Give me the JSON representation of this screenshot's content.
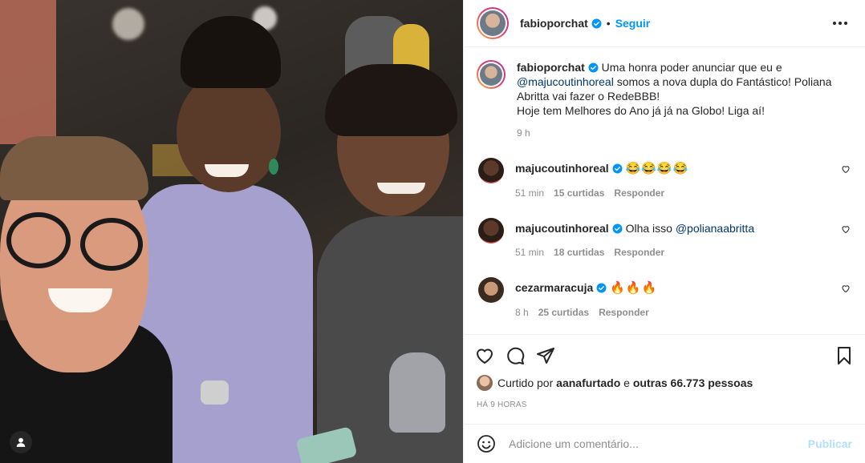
{
  "post": {
    "author": "fabioporchat",
    "follow_label": "Seguir",
    "caption_parts": {
      "p1": "Uma honra poder anunciar que eu e ",
      "mention": "@majucoutinhoreal",
      "p2": " somos a nova dupla do Fantástico! Poliana Abritta vai fazer o RedeBBB!",
      "p3": "Hoje tem Melhores do Ano já já na Globo! Liga aí!"
    },
    "caption_time": "9 h"
  },
  "comments": [
    {
      "user": "majucoutinhoreal",
      "text": "😂😂😂😂",
      "mention": "",
      "time": "51 min",
      "likes": "15 curtidas",
      "reply": "Responder"
    },
    {
      "user": "majucoutinhoreal",
      "text": "Olha isso ",
      "mention": "@polianaabritta",
      "time": "51 min",
      "likes": "18 curtidas",
      "reply": "Responder"
    },
    {
      "user": "cezarmaracuja",
      "text": "🔥🔥🔥",
      "mention": "",
      "time": "8 h",
      "likes": "25 curtidas",
      "reply": "Responder"
    }
  ],
  "likes_line": {
    "prefix": "Curtido por ",
    "user": "aanafurtado",
    "middle": " e ",
    "others": "outras 66.773 pessoas"
  },
  "time_ago": "HÁ 9 HORAS",
  "comment_input": {
    "placeholder": "Adicione um comentário...",
    "publish_label": "Publicar"
  },
  "colors": {
    "accent_blue": "#0095f6",
    "publish_disabled": "#b2dffc",
    "mention": "#00376b"
  }
}
